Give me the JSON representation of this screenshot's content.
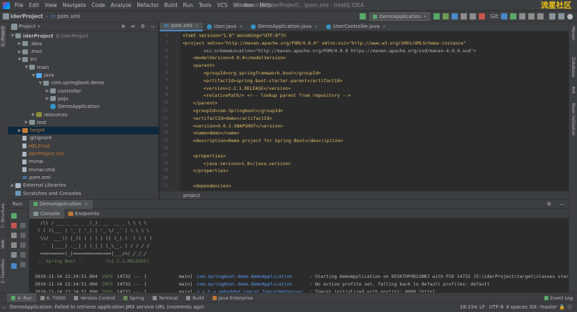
{
  "menubar": {
    "items": [
      "File",
      "Edit",
      "View",
      "Navigate",
      "Code",
      "Analyze",
      "Refactor",
      "Build",
      "Run",
      "Tools",
      "VCS",
      "Window",
      "Help"
    ],
    "window_title": "demo [E:\\iderProject\\...\\pom.xml - IntelliJ IDEA",
    "watermark": "流星社区"
  },
  "navbar": {
    "project": "iderProject",
    "file": "pom.xml",
    "run_config": "DemoApplication",
    "git_label": "Git:"
  },
  "left_strip": {
    "tabs": [
      "1: Project",
      "7: Structure",
      "2: Favorites",
      "Web"
    ]
  },
  "right_strip": {
    "tabs": [
      "Maven",
      "Database",
      "Ant",
      "Bean Validation"
    ]
  },
  "project_panel": {
    "title": "Project",
    "tree": [
      {
        "label": "iderProject",
        "extra": "E:\\iderProject",
        "depth": 0,
        "arrow": "▼",
        "icon": "folder"
      },
      {
        "label": ".idea",
        "depth": 1,
        "arrow": "▶",
        "icon": "folder",
        "color": "#bbbbbb"
      },
      {
        "label": ".mvn",
        "depth": 1,
        "arrow": "▶",
        "icon": "folder"
      },
      {
        "label": "src",
        "depth": 1,
        "arrow": "▼",
        "icon": "folder"
      },
      {
        "label": "main",
        "depth": 2,
        "arrow": "▼",
        "icon": "folder"
      },
      {
        "label": "java",
        "depth": 3,
        "arrow": "▼",
        "icon": "folder-src"
      },
      {
        "label": "com.springboot.demo",
        "depth": 4,
        "arrow": "▼",
        "icon": "folder"
      },
      {
        "label": "controller",
        "depth": 5,
        "arrow": "▶",
        "icon": "folder"
      },
      {
        "label": "pojo",
        "depth": 5,
        "arrow": "▶",
        "icon": "folder"
      },
      {
        "label": "DemoApplication",
        "depth": 5,
        "arrow": "",
        "icon": "class"
      },
      {
        "label": "resources",
        "depth": 3,
        "arrow": "▶",
        "icon": "folder-res"
      },
      {
        "label": "test",
        "depth": 2,
        "arrow": "▶",
        "icon": "folder"
      },
      {
        "label": "target",
        "depth": 1,
        "arrow": "▶",
        "icon": "folder-target",
        "color": "#c07a36"
      },
      {
        "label": ".gitignore",
        "depth": 1,
        "arrow": "",
        "icon": "file"
      },
      {
        "label": "HELP.md",
        "depth": 1,
        "arrow": "",
        "icon": "file",
        "color": "#c07a36"
      },
      {
        "label": "iderProject.iml",
        "depth": 1,
        "arrow": "",
        "icon": "file",
        "color": "#c07a36"
      },
      {
        "label": "mvnw",
        "depth": 1,
        "arrow": "",
        "icon": "file"
      },
      {
        "label": "mvnw.cmd",
        "depth": 1,
        "arrow": "",
        "icon": "file"
      },
      {
        "label": "pom.xml",
        "depth": 1,
        "arrow": "",
        "icon": "m"
      },
      {
        "label": "External Libraries",
        "depth": 0,
        "arrow": "▶",
        "icon": "lib"
      },
      {
        "label": "Scratches and Consoles",
        "depth": 0,
        "arrow": "",
        "icon": "scratch"
      }
    ]
  },
  "editor_tabs": [
    {
      "label": "pom.xml",
      "active": true
    },
    {
      "label": "User.java",
      "active": false
    },
    {
      "label": "DemoApplication.java",
      "active": false
    },
    {
      "label": "UserController.java",
      "active": false
    }
  ],
  "editor": {
    "lines": [
      {
        "n": "1",
        "text": "<?xml version=\"1.0\" encoding=\"UTF-8\"?>",
        "indent": 0
      },
      {
        "n": "2",
        "text": "<project xmlns=\"http://maven.apache.org/POM/4.0.0\" xmlns:xsi=\"http://www.w3.org/2001/XMLSchema-instance\"",
        "indent": 0
      },
      {
        "n": "3",
        "text": "xsi:schemaLocation=\"http://maven.apache.org/POM/4.0.0 https://maven.apache.org/xsd/maven-4.0.0.xsd\">",
        "indent": 2,
        "attr": true
      },
      {
        "n": "4",
        "text": "<modelVersion>4.0.0</modelVersion>",
        "indent": 1
      },
      {
        "n": "5",
        "text": "<parent>",
        "indent": 1
      },
      {
        "n": "6",
        "text": "<groupId>org.springframework.boot</groupId>",
        "indent": 2
      },
      {
        "n": "7",
        "text": "<artifactId>spring-boot-starter-parent</artifactId>",
        "indent": 2
      },
      {
        "n": "8",
        "text": "<version>2.2.1.RELEASE</version>",
        "indent": 2
      },
      {
        "n": "9",
        "text": "<relativePath/> <!-- lookup parent from repository -->",
        "indent": 2
      },
      {
        "n": "10",
        "text": "</parent>",
        "indent": 1
      },
      {
        "n": "11",
        "text": "<groupId>com.Springboot</groupId>",
        "indent": 1
      },
      {
        "n": "12",
        "text": "<artifactId>demo</artifactId>",
        "indent": 1
      },
      {
        "n": "13",
        "text": "<version>0.0.1-SNAPSHOT</version>",
        "indent": 1
      },
      {
        "n": "14",
        "text": "<name>demo</name>",
        "indent": 1
      },
      {
        "n": "15",
        "text": "<description>Demo project for Spring Boot</description>",
        "indent": 1
      },
      {
        "n": "16",
        "text": "",
        "indent": 0
      },
      {
        "n": "17",
        "text": "<properties>",
        "indent": 1
      },
      {
        "n": "18",
        "text": "<java.version>1.8</java.version>",
        "indent": 2
      },
      {
        "n": "19",
        "text": "</properties>",
        "indent": 1
      },
      {
        "n": "20",
        "text": "",
        "indent": 0
      },
      {
        "n": "21",
        "text": "<dependencies>",
        "indent": 1
      }
    ],
    "breadcrumb": "project"
  },
  "run_panel": {
    "label": "Run:",
    "config_tab": "DemoApplication",
    "subtabs": [
      "Console",
      "Endpoints"
    ],
    "console": [
      {
        "text": "  /\\\\ / ___'_ __ _ _(_)_ __  __ _ \\ \\ \\ \\",
        "type": "banner"
      },
      {
        "text": " ( ( )\\___ | '_ | '_| | '_ \\/ _` | \\ \\ \\ \\",
        "type": "banner"
      },
      {
        "text": "  \\\\/  ___)| |_)| | | | | || (_| |  ) ) ) )",
        "type": "banner"
      },
      {
        "text": "   '  |____| .__|_| |_|_| |_\\__, | / / / /",
        "type": "banner"
      },
      {
        "text": "  =========|_|==============|___/=/_/_/_/",
        "type": "banner"
      },
      {
        "text": " :: Spring Boot ::        (v2.2.1.RELEASE)",
        "type": "spring"
      },
      {
        "text": "",
        "type": "blank"
      },
      {
        "time": "2019-11-14 22:24:51.064",
        "level": "INFO",
        "pid": "14732 --- [",
        "thread": "main]",
        "logger": "com.springboot.demo.DemoApplication",
        "msg": ": Starting DemoApplication on DESKTOPHD22NRJ with PID 14732 (E:\\iderProject\\target\\classes start",
        "type": "log"
      },
      {
        "time": "2019-11-14 22:24:51.066",
        "level": "INFO",
        "pid": "14732 --- [",
        "thread": "main]",
        "logger": "com.springboot.demo.DemoApplication",
        "msg": ": No active profile set, falling back to default profiles: default",
        "type": "log"
      },
      {
        "time": "2019-11-14 22:24:51.890",
        "level": "INFO",
        "pid": "14732 --- [",
        "thread": "main]",
        "logger": "o.s.b.w.embedded.tomcat.TomcatWebServer",
        "msg": ": Tomcat initialized with port(s): 8080 (http)",
        "type": "log"
      }
    ]
  },
  "bottom_tools": [
    {
      "label": "4: Run",
      "active": true,
      "color": "#59a869"
    },
    {
      "label": "6: TODO",
      "active": false,
      "color": "#8c8c8c"
    },
    {
      "label": "Version Control",
      "active": false,
      "color": "#8c8c8c"
    },
    {
      "label": "Spring",
      "active": false,
      "color": "#6a8759"
    },
    {
      "label": "Terminal",
      "active": false,
      "color": "#8c8c8c"
    },
    {
      "label": "Build",
      "active": false,
      "color": "#8c8c8c"
    },
    {
      "label": "Java Enterprise",
      "active": false,
      "color": "#c07a36"
    }
  ],
  "event_log": "Event Log",
  "statusbar": {
    "message": "DemoApplication: Failed to retrieve application JMX service URL (moments ago)",
    "position": "18:154",
    "line_sep": "LF",
    "encoding": "UTF-8",
    "indent": "4 spaces",
    "git": "Git: master"
  },
  "colors": {
    "accent": "#4a88c7",
    "tag": "#e8bf6a",
    "string": "#6a8759"
  }
}
